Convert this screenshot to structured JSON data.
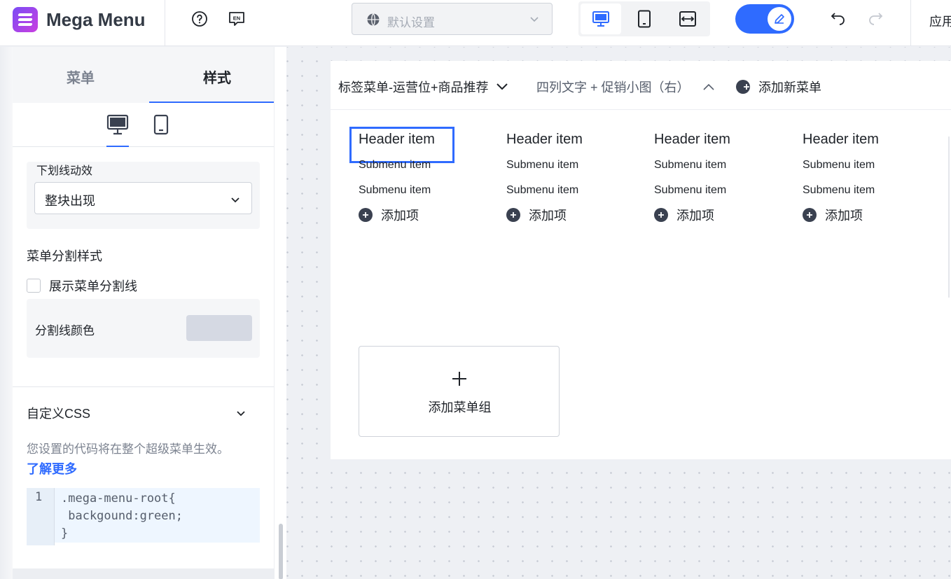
{
  "app": {
    "title": "Mega Menu"
  },
  "toolbar": {
    "language_select": "默认设置",
    "apply_label": "应用",
    "help_icon": "help-icon",
    "language_icon": "EN"
  },
  "sidebar": {
    "tabs": [
      {
        "label": "菜单",
        "active": false
      },
      {
        "label": "样式",
        "active": true
      }
    ],
    "animation_label": "下划线动效",
    "animation_value": "整块出现",
    "separator_section_title": "菜单分割样式",
    "show_separator_label": "展示菜单分割线",
    "show_separator_checked": false,
    "separator_color_label": "分割线颜色",
    "separator_color": "#d5d9e3",
    "custom_css_title": "自定义CSS",
    "custom_css_desc": "您设置的代码将在整个超级菜单生效。",
    "learn_more": "了解更多",
    "code": {
      "line_number": "1",
      "lines": [
        ".mega-menu-root{",
        " backgound:green;",
        "}"
      ]
    }
  },
  "preview": {
    "tabs": [
      {
        "label": "标签菜单-运营位+商品推荐"
      },
      {
        "label": "四列文字 + 促销小图（右）"
      },
      {
        "label": "添加新菜单"
      }
    ],
    "columns": [
      {
        "header": "Header item",
        "subs": [
          "Submenu item",
          "Submenu item"
        ],
        "add": "添加项"
      },
      {
        "header": "Header item",
        "subs": [
          "Submenu item",
          "Submenu item"
        ],
        "add": "添加项"
      },
      {
        "header": "Header item",
        "subs": [
          "Submenu item",
          "Submenu item"
        ],
        "add": "添加项"
      },
      {
        "header": "Header item",
        "subs": [
          "Submenu item",
          "Submenu item"
        ],
        "add": "添加项"
      }
    ],
    "add_group_label": "添加菜单组"
  },
  "colors": {
    "accent": "#2f6bff",
    "brand": "#7a4cf5"
  }
}
